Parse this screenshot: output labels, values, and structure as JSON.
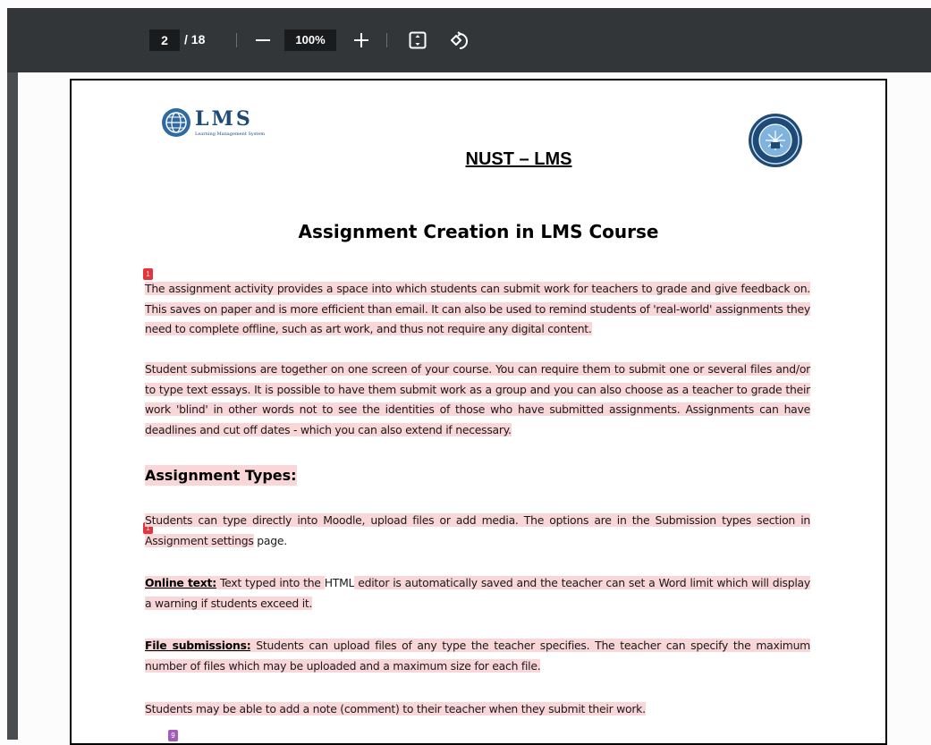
{
  "toolbar": {
    "current_page": "2",
    "total_pages": "/ 18",
    "zoom_level": "100%"
  },
  "document": {
    "logo_text": "LMS",
    "logo_subtitle": "Learning Management System",
    "title": "NUST – LMS",
    "heading": "Assignment Creation in LMS Course",
    "paragraphs": {
      "p1": "The assignment activity provides a space into which students can submit work for teachers to grade and give feedback on. This saves on paper and is more efficient than email. It can also be used to remind students of 'real-world' assignments they need to complete offline, such as art work, and thus not require any digital content.",
      "p2": "Student submissions are together on one screen of your course. You can require them to submit one or several files and/or to type text essays. It is possible to have them submit work as a group and you can also choose as a teacher to grade their work 'blind' in other words not to see the identities of those who have submitted assignments. Assignments can have deadlines and cut off dates - which you can also extend if necessary.",
      "types_heading": "Assignment Types:",
      "p3_highlighted": "Students can type directly into Moodle, upload files or add media. The options are in the Submission types section in Assignment settings",
      "p3_tail": " page.",
      "online_label": "Online text:",
      "online_a": " Text typed into the ",
      "online_html": "HTML",
      "online_b": " editor is automatically saved and the teacher can set a Word limit which will display a warning if students exceed it.",
      "file_label": "File submissions:",
      "file_text": " Students can upload files of any type the teacher specifies. The teacher can specify the maximum number of files which may be uploaded and a maximum size for each file.",
      "note_text": "Students may be able to add a note (comment) to their teacher when they submit their work."
    },
    "markers": {
      "m1": "1",
      "m2": "1",
      "m3": "9"
    }
  },
  "colors": {
    "toolbar_bg": "#323639",
    "highlight": "#f9d6d8",
    "marker_red": "#e8333a",
    "marker_purple": "#a55bb8",
    "logo_blue": "#1e4a78"
  },
  "icons": [
    "minus-icon",
    "plus-icon",
    "fit-page-icon",
    "rotate-icon"
  ]
}
